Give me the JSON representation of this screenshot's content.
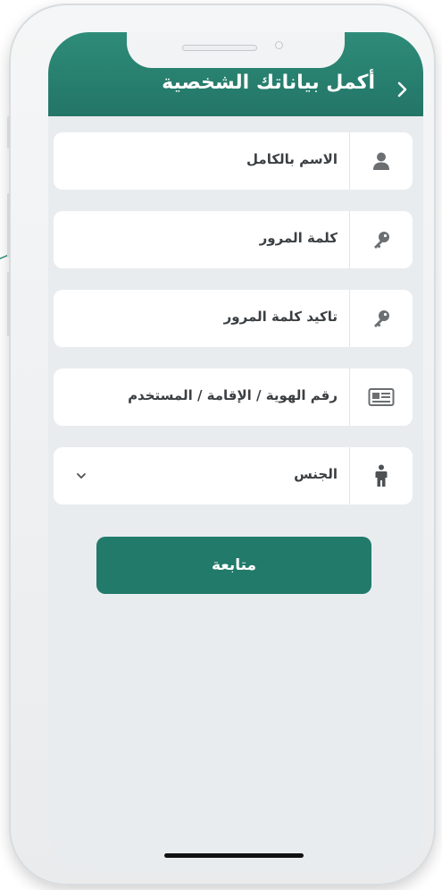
{
  "header": {
    "title": "أكمل بياناتك الشخصية"
  },
  "form": {
    "fields": [
      {
        "label": "الاسم بالكامل",
        "icon": "user-icon"
      },
      {
        "label": "كلمة المرور",
        "icon": "key-icon"
      },
      {
        "label": "تاكيد كلمة المرور",
        "icon": "key-icon"
      },
      {
        "label": "رقم الهوية / الإقامة / المستخدم",
        "icon": "id-card-icon"
      },
      {
        "label": "الجنس",
        "icon": "person-icon"
      }
    ],
    "submit_label": "متابعة"
  },
  "colors": {
    "brand": "#237567",
    "button": "#217a6a",
    "icon": "#6b6f72"
  }
}
